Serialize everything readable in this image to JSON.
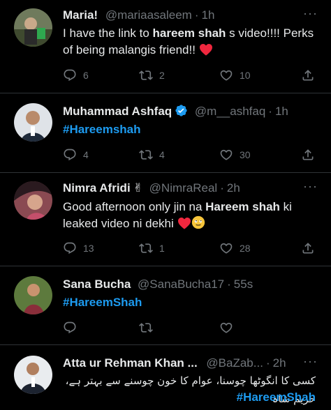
{
  "tweets": [
    {
      "name": "Maria!",
      "handle": "@mariaasaleem",
      "time": "1h",
      "text_pre": "I have the link to ",
      "text_bold": "hareem shah",
      "text_post": " s video!!!! Perks of being malangis friend!!",
      "replies": "6",
      "retweets": "2",
      "likes": "10"
    },
    {
      "name": "Muhammad Ashfaq",
      "handle": "@m__ashfaq",
      "time": "1h",
      "hashtag": "#Hareemshah",
      "replies": "4",
      "retweets": "4",
      "likes": "30"
    },
    {
      "name": "Nimra Afridi",
      "handle": "@NimraReal",
      "time": "2h",
      "text_pre": "Good afternoon only jin na ",
      "text_bold": "Hareem shah",
      "text_post": " ki leaked video ni dekhi",
      "replies": "13",
      "retweets": "1",
      "likes": "28"
    },
    {
      "name": "Sana Bucha",
      "handle": "@SanaBucha17",
      "time": "55s",
      "hashtag": "#HareemShah"
    },
    {
      "name": "Atta ur Rehman Khan ...",
      "handle": "@BaZab...",
      "time": "2h",
      "urdu": "کسی کا انگوٹھا چوسنا، عوام کا خون چوسنے سے بہتر ہے، حریم شاہ",
      "hashtag": "#HareemShah"
    }
  ],
  "icons": {
    "reply": "reply-icon",
    "retweet": "retweet-icon",
    "like": "heart-icon",
    "share": "share-icon",
    "more": "more-icon",
    "verified": "verified-badge-icon"
  },
  "colors": {
    "background": "#000000",
    "text": "#e7e9ea",
    "muted": "#71767b",
    "accent": "#1d9bf0",
    "divider": "#2f3336",
    "heart": "#f91880"
  }
}
